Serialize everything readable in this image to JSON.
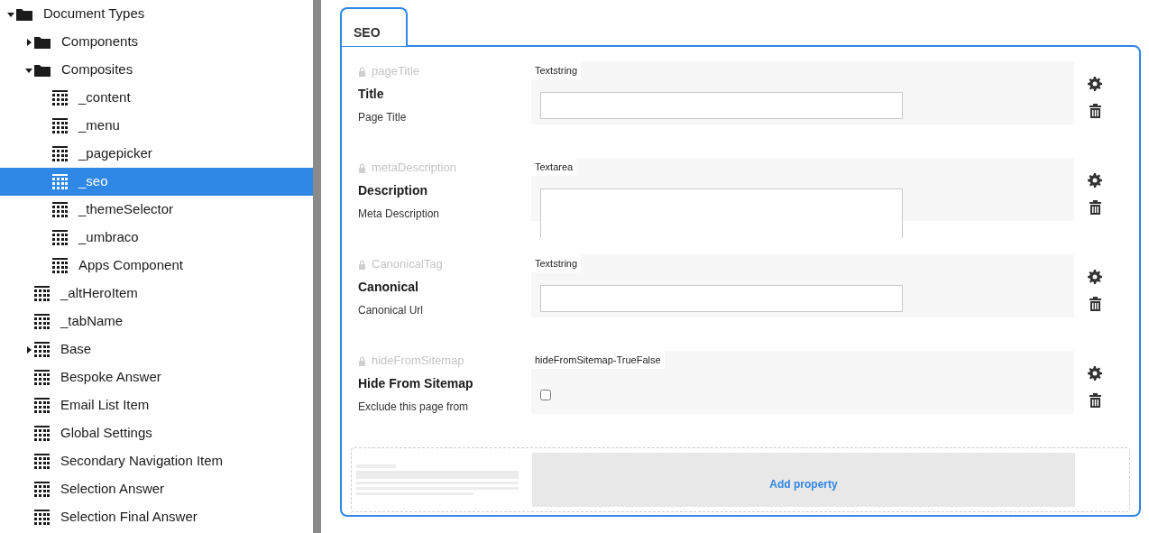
{
  "tree": [
    {
      "label": "Document Types",
      "kind": "folder",
      "expanded": true,
      "selected": false,
      "children": [
        {
          "label": "Components",
          "kind": "folder",
          "expanded": false,
          "selected": false
        },
        {
          "label": "Composites",
          "kind": "folder",
          "expanded": true,
          "selected": false,
          "children": [
            {
              "label": "_content",
              "kind": "doctype",
              "selected": false
            },
            {
              "label": "_menu",
              "kind": "doctype",
              "selected": false
            },
            {
              "label": "_pagepicker",
              "kind": "doctype",
              "selected": false
            },
            {
              "label": "_seo",
              "kind": "doctype",
              "selected": true
            },
            {
              "label": "_themeSelector",
              "kind": "doctype",
              "selected": false
            },
            {
              "label": "_umbraco",
              "kind": "doctype",
              "selected": false
            },
            {
              "label": "Apps Component",
              "kind": "doctype",
              "selected": false
            }
          ]
        },
        {
          "label": "_altHeroItem",
          "kind": "doctype",
          "selected": false
        },
        {
          "label": "_tabName",
          "kind": "doctype",
          "selected": false
        },
        {
          "label": "Base",
          "kind": "doctype",
          "selected": false,
          "expanded": false
        },
        {
          "label": "Bespoke Answer",
          "kind": "doctype",
          "selected": false
        },
        {
          "label": "Email List Item",
          "kind": "doctype",
          "selected": false
        },
        {
          "label": "Global Settings",
          "kind": "doctype",
          "selected": false
        },
        {
          "label": "Secondary Navigation Item",
          "kind": "doctype",
          "selected": false
        },
        {
          "label": "Selection Answer",
          "kind": "doctype",
          "selected": false
        },
        {
          "label": "Selection Final Answer",
          "kind": "doctype",
          "selected": false
        }
      ]
    }
  ],
  "tabs": [
    {
      "label": "SEO",
      "selected": true
    }
  ],
  "properties": [
    {
      "alias": "pageTitle",
      "name": "Title",
      "description": "Page Title",
      "editor": "Textstring",
      "kind": "textstring"
    },
    {
      "alias": "metaDescription",
      "name": "Description",
      "description": "Meta Description",
      "editor": "Textarea",
      "kind": "textarea"
    },
    {
      "alias": "CanonicalTag",
      "name": "Canonical",
      "description": "Canonical Url",
      "editor": "Textstring",
      "kind": "textstring"
    },
    {
      "alias": "hideFromSitemap",
      "name": "Hide From Sitemap",
      "description": "Exclude this page from",
      "editor": "hideFromSitemap-TrueFalse",
      "kind": "checkbox",
      "checked": false
    }
  ],
  "add_property": {
    "label": "Add property"
  }
}
